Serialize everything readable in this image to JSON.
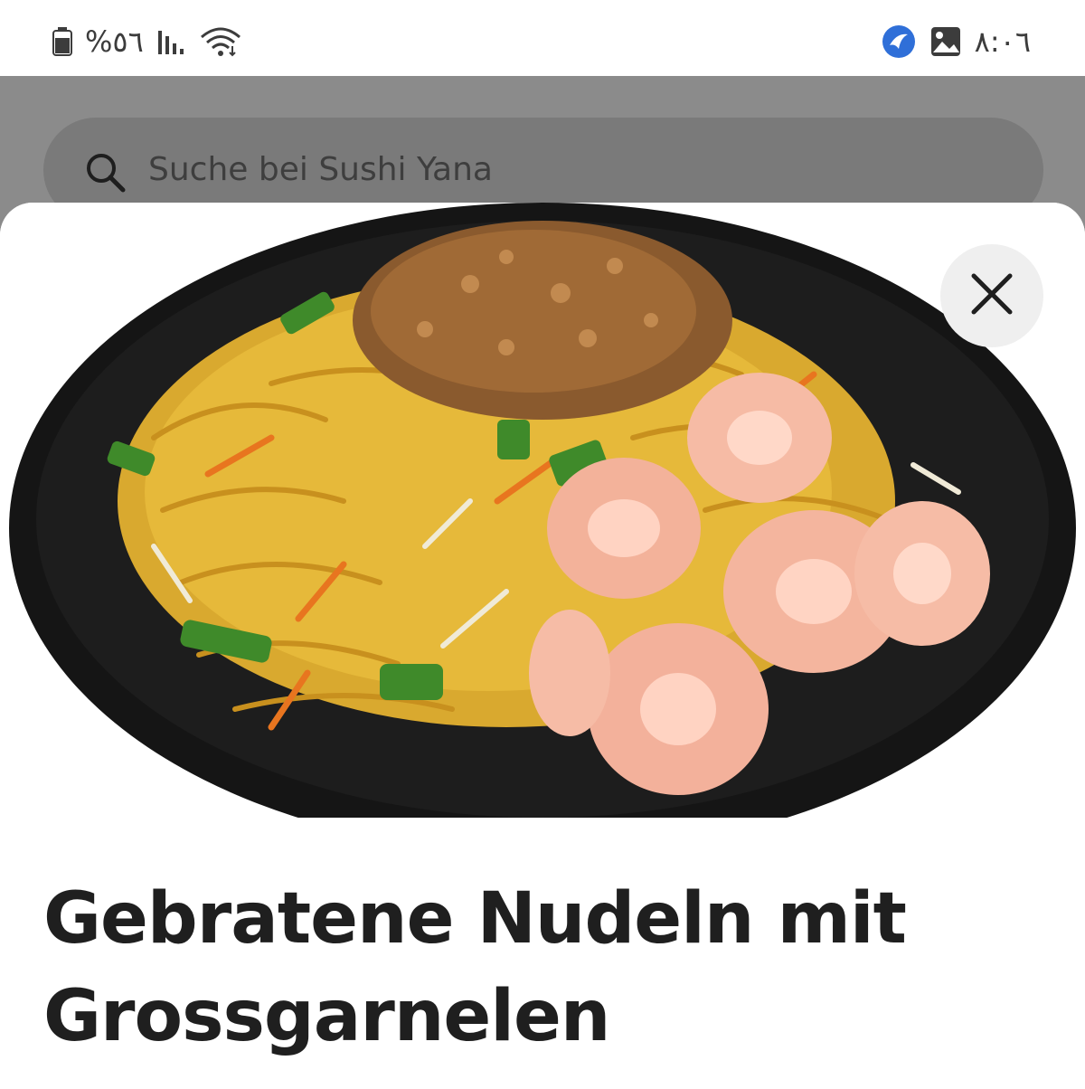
{
  "status_bar": {
    "battery": "%٥٦",
    "time": "٨:٠٦",
    "icons": [
      "battery-icon",
      "signal-icon",
      "wifi-icon",
      "app-notification-icon",
      "gallery-icon"
    ]
  },
  "search": {
    "placeholder": "Suche bei Sushi Yana",
    "icon": "search-icon"
  },
  "modal": {
    "image_description_icon": "dish-photo",
    "close_icon": "close-icon",
    "title": "Gebratene Nudeln mit Grossgarnelen"
  },
  "colors": {
    "title": "#1f1f1f",
    "overlay": "#8b8b8b",
    "sheet": "#ffffff",
    "close_bg": "#efefef"
  }
}
